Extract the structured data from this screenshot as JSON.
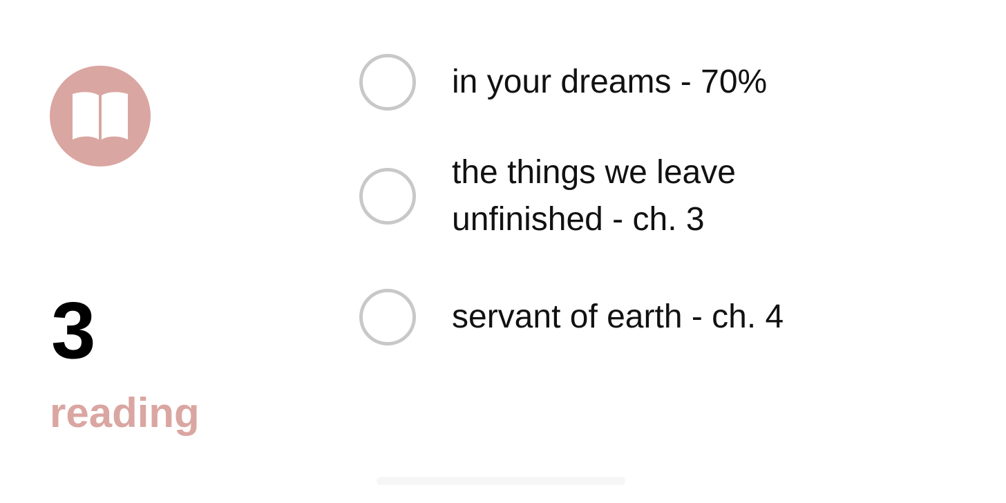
{
  "widget": {
    "accent_color": "#daa6a1",
    "icon": "book-icon",
    "count": "3",
    "list_name": "reading"
  },
  "tasks": [
    {
      "label": "in your dreams - 70%",
      "completed": false
    },
    {
      "label": "the things we leave unfinished - ch. 3",
      "completed": false
    },
    {
      "label": "servant of earth - ch. 4",
      "completed": false
    }
  ]
}
